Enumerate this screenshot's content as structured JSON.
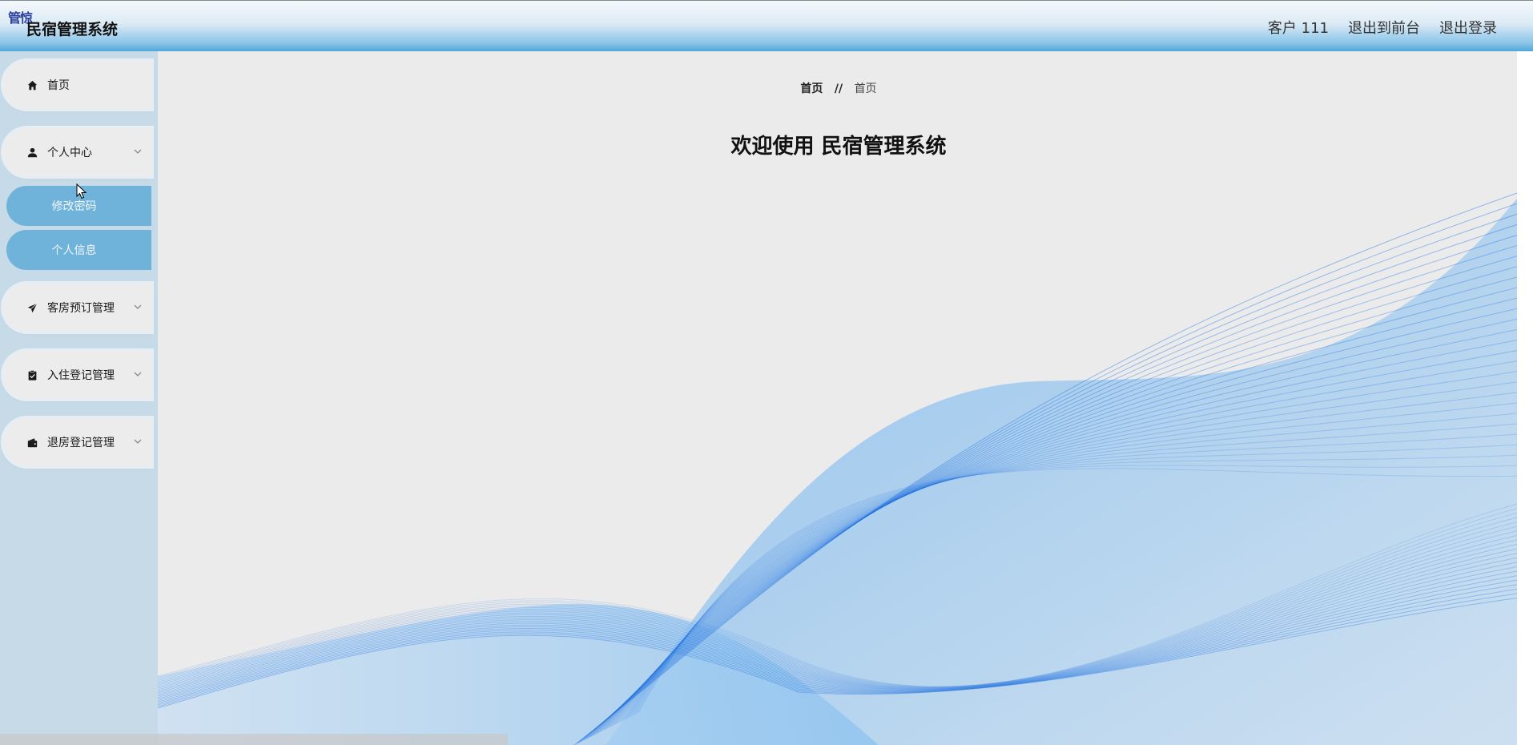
{
  "header": {
    "badge": "管惊",
    "title": "民宿管理系统",
    "user": "客户 111",
    "to_front": "退出到前台",
    "logout": "退出登录"
  },
  "sidebar": {
    "items": [
      {
        "label": "首页",
        "icon": "home-icon"
      },
      {
        "label": "个人中心",
        "icon": "user-icon",
        "expanded": true,
        "children": [
          {
            "label": "修改密码"
          },
          {
            "label": "个人信息"
          }
        ]
      },
      {
        "label": "客房预订管理",
        "icon": "paper-plane-icon"
      },
      {
        "label": "入住登记管理",
        "icon": "clipboard-check-icon"
      },
      {
        "label": "退房登记管理",
        "icon": "wallet-icon"
      }
    ]
  },
  "main": {
    "breadcrumb": {
      "home": "首页",
      "separator": "//",
      "current": "首页"
    },
    "welcome": "欢迎使用 民宿管理系统"
  },
  "colors": {
    "header_gradient_end": "#4fa6db",
    "sidebar_bg": "#c6dbe7",
    "submenu_bg": "#6fb3db",
    "main_bg": "#ebebeb",
    "wave_blue": "#1e6fe0"
  }
}
